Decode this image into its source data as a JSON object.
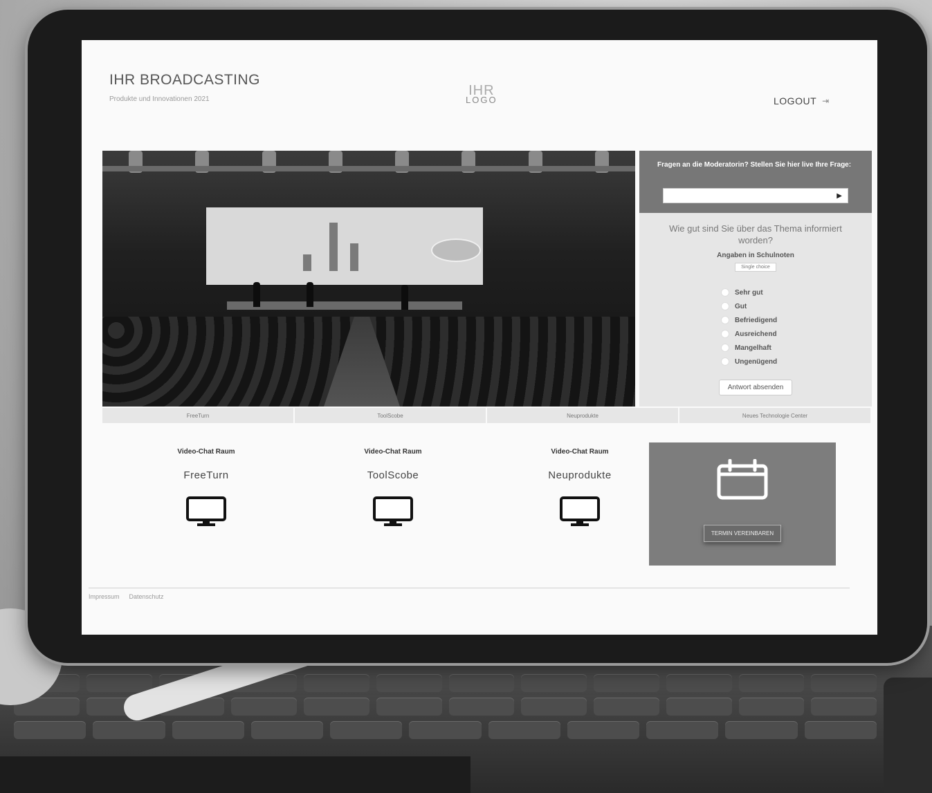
{
  "header": {
    "title": "IHR BROADCASTING",
    "subtitle": "Produkte und Innovationen 2021",
    "logo_top": "IHR",
    "logo_bottom": "LOGO",
    "logout_label": "LOGOUT",
    "logout_icon": "logout-arrow-icon"
  },
  "stream": {
    "tabs": [
      "FreeTurn",
      "ToolScobe",
      "Neuprodukte",
      "Neues Technologie Center"
    ]
  },
  "questions": {
    "prompt": "Fragen an die Moderatorin? Stellen Sie hier live Ihre Frage:",
    "input_value": "",
    "send_icon": "play-icon",
    "poll_title": "Wie gut sind Sie über das Thema informiert worden?",
    "poll_note": "Angaben in Schulnoten",
    "poll_badge": "Single choice",
    "options": [
      "Sehr gut",
      "Gut",
      "Befriedigend",
      "Ausreichend",
      "Mangelhaft",
      "Ungenügend"
    ],
    "submit_label": "Antwort absenden"
  },
  "rooms": [
    {
      "kicker": "Video-Chat Raum",
      "name": "FreeTurn",
      "icon": "monitor-icon"
    },
    {
      "kicker": "Video-Chat Raum",
      "name": "ToolScobe",
      "icon": "monitor-icon"
    },
    {
      "kicker": "Video-Chat Raum",
      "name": "Neuprodukte",
      "icon": "monitor-icon"
    }
  ],
  "appointment": {
    "icon": "calendar-icon",
    "button_label": "TERMIN VEREINBAREN"
  },
  "footer": {
    "links": [
      "Impressum",
      "Datenschutz"
    ]
  },
  "colors": {
    "panel_dark": "#777777",
    "panel_light": "#e6e6e6",
    "appointment_bg": "#7d7d7d"
  }
}
